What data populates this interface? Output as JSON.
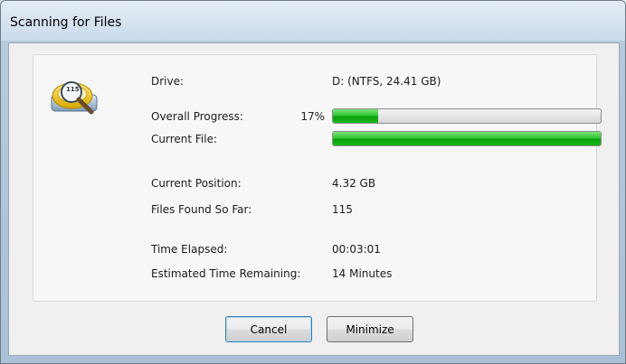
{
  "window": {
    "title": "Scanning for Files"
  },
  "icon": {
    "name": "drive-search-icon",
    "badge_text": "115"
  },
  "fields": {
    "drive_label": "Drive:",
    "drive_value": "D: (NTFS, 24.41 GB)",
    "overall_label": "Overall Progress:",
    "overall_percent_text": "17%",
    "overall_progress": 0.17,
    "current_file_label": "Current File:",
    "current_file_progress": 1.0,
    "position_label": "Current Position:",
    "position_value": "4.32 GB",
    "found_label": "Files Found So Far:",
    "found_value": "115",
    "elapsed_label": "Time Elapsed:",
    "elapsed_value": "00:03:01",
    "remaining_label": "Estimated Time Remaining:",
    "remaining_value": "14 Minutes"
  },
  "buttons": {
    "cancel": "Cancel",
    "minimize": "Minimize"
  },
  "colors": {
    "progress_green": "#1fb51f",
    "frame_blue": "#aac0d6"
  }
}
